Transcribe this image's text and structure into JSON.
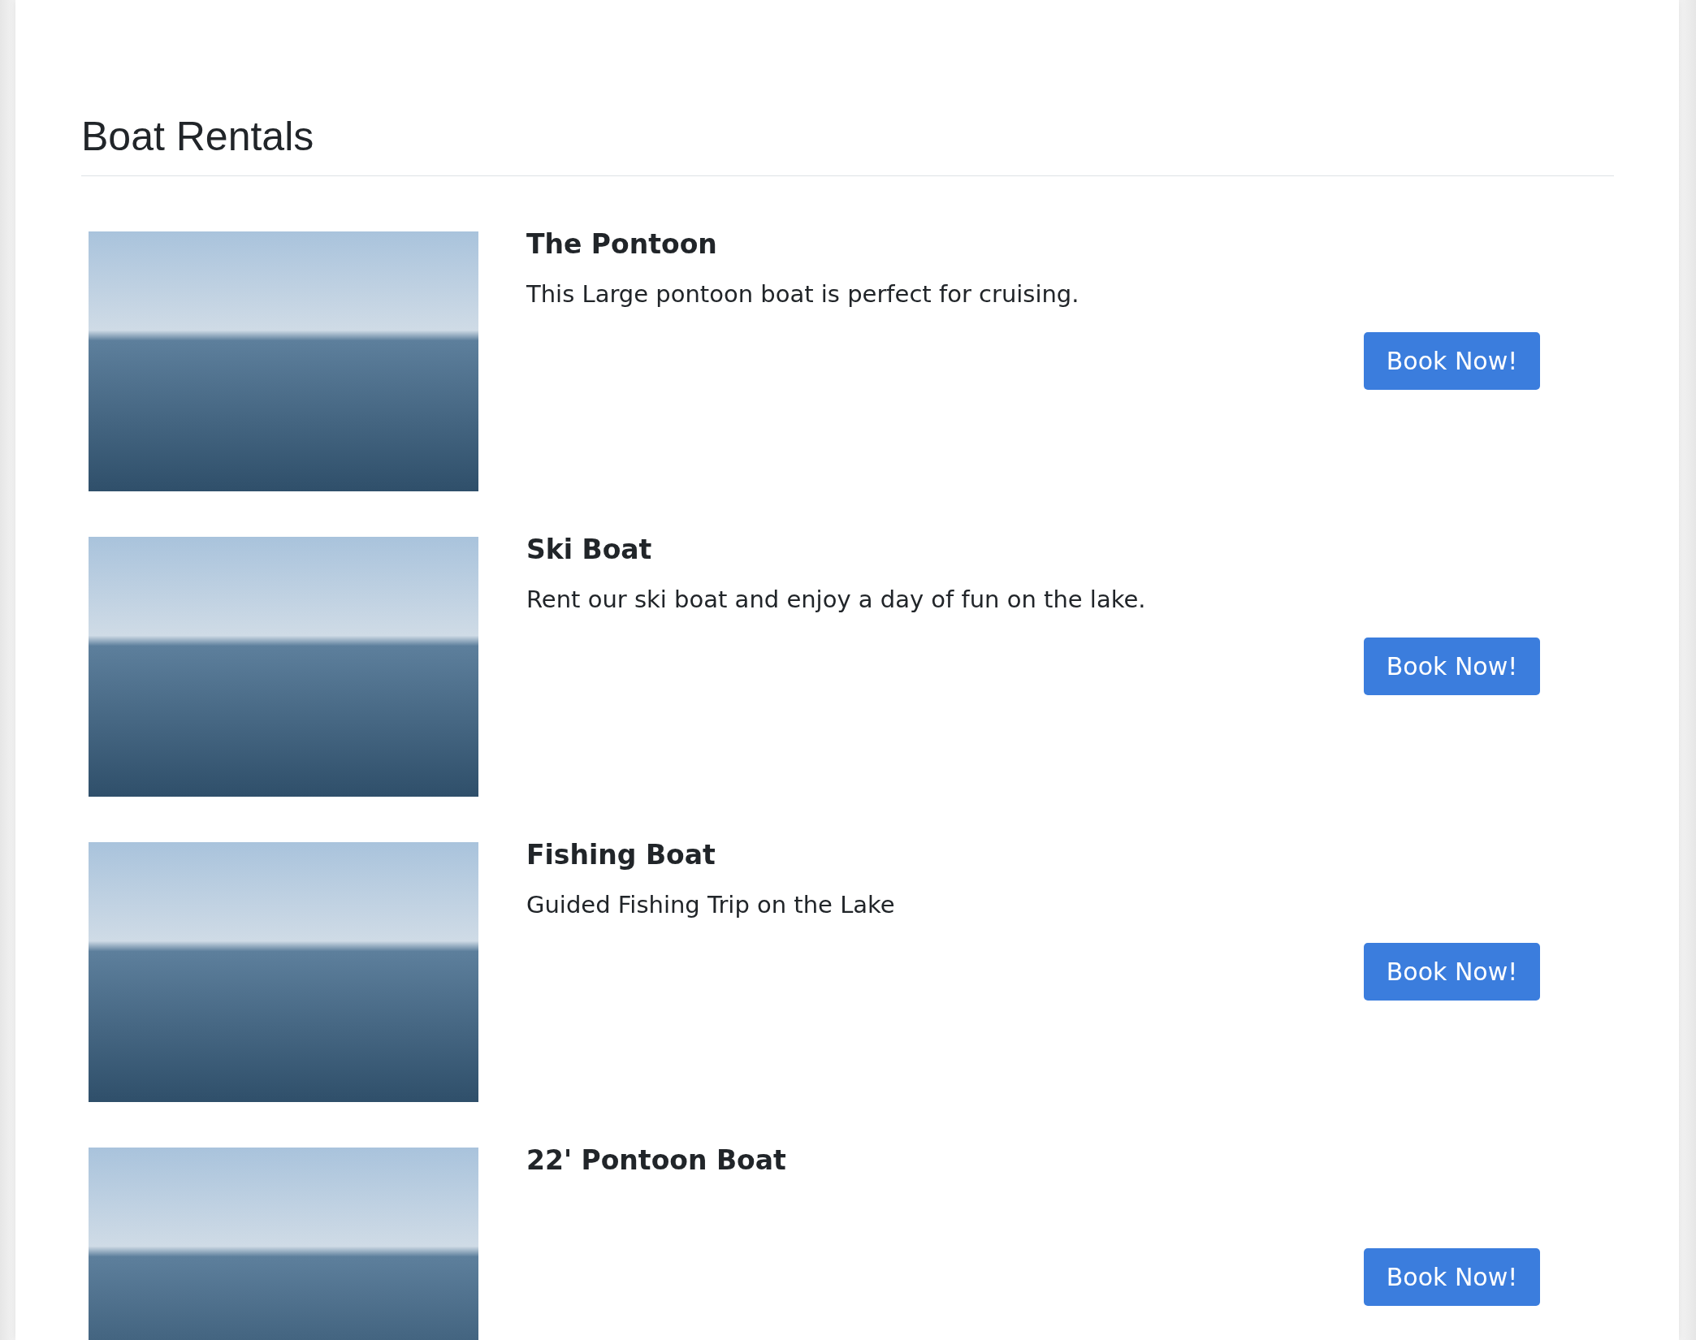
{
  "page": {
    "title": "Boat Rentals"
  },
  "rentals": [
    {
      "name": "The Pontoon",
      "description": "This Large pontoon boat is perfect for cruising.",
      "button": "Book Now!"
    },
    {
      "name": "Ski Boat",
      "description": "Rent our ski boat and enjoy a day of fun on the lake.",
      "button": "Book Now!"
    },
    {
      "name": "Fishing Boat",
      "description": "Guided Fishing Trip on the Lake",
      "button": "Book Now!"
    },
    {
      "name": "22' Pontoon Boat",
      "button": "Book Now!"
    }
  ]
}
